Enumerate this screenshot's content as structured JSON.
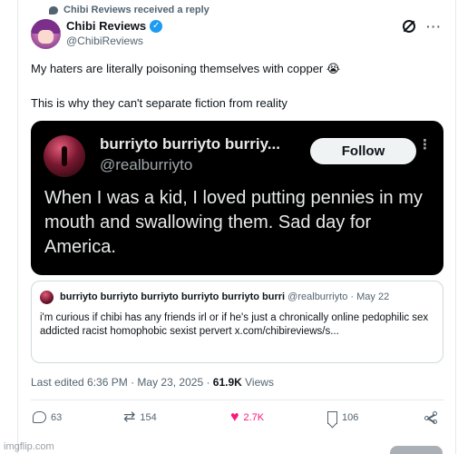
{
  "reply_note": "Chibi Reviews received a reply",
  "author": {
    "display_name": "Chibi Reviews",
    "verified_mark": "✓",
    "handle": "@ChibiReviews"
  },
  "top_icons": [
    "grok-icon",
    "more-icon"
  ],
  "more_label": "···",
  "tweet": {
    "line1": "My haters are literally poisoning themselves with copper 😭",
    "line2": "This is why they can't separate fiction from reality"
  },
  "media_card": {
    "name": "burriyto burriyto burriy...",
    "handle": "@realburriyto",
    "follow_label": "Follow",
    "more_label": "⋮",
    "text": "When I was a kid, I loved putting pennies in my mouth and swallowing them. Sad day for America."
  },
  "quote": {
    "name": "burriyto burriyto burriyto burriyto burriyto burri",
    "meta": " @realburriyto · May 22",
    "body": "i'm curious if chibi has any friends irl or if he's just a chronically online pedophilic sex addicted racist homophobic sexist pervert x.com/chibireviews/s..."
  },
  "meta": {
    "edited": "Last edited 6:36 PM · May 23, 2025 · ",
    "views_count": "61.9K",
    "views_label": " Views"
  },
  "actions": {
    "replies": "63",
    "retweets": "154",
    "likes": "2.7K",
    "bookmarks": "106"
  },
  "colors": {
    "like_pink": "#f91880",
    "verified_blue": "#1d9bf0",
    "secondary_text": "#536471"
  },
  "watermark": "imgflip.com"
}
